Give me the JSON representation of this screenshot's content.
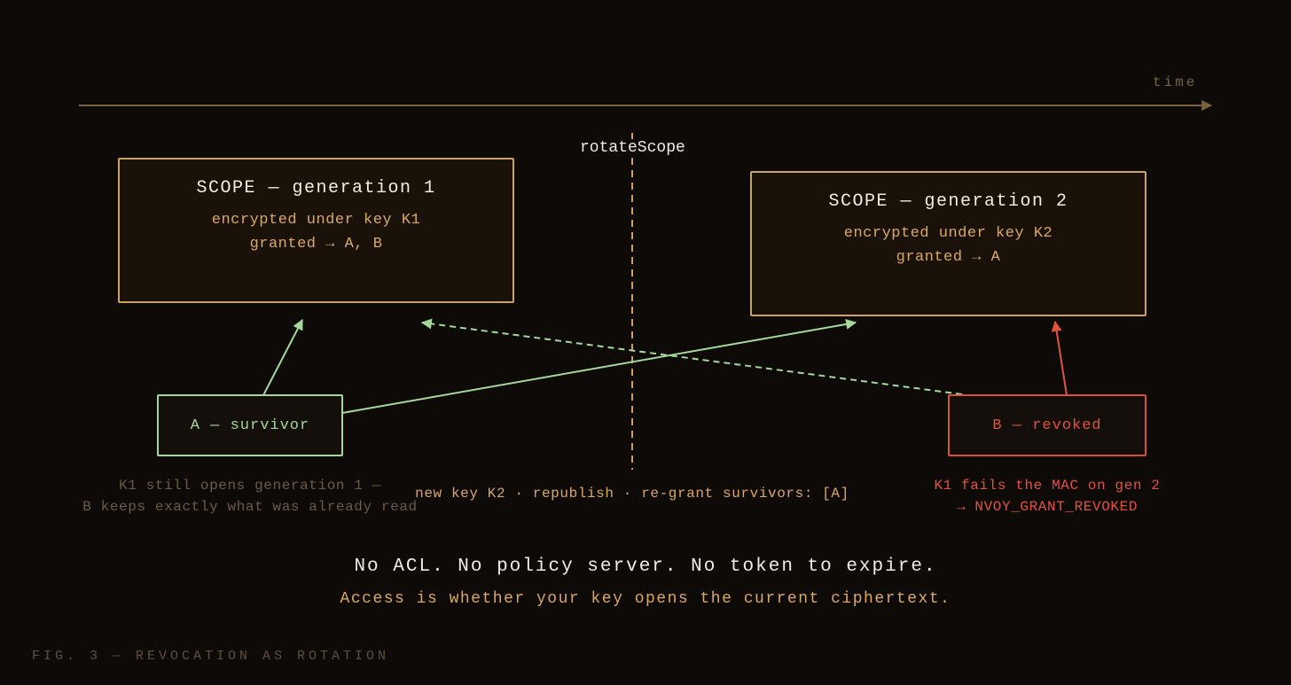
{
  "timeline": {
    "label": "time"
  },
  "rotation": {
    "label": "rotateScope",
    "caption": "new key K2 · republish · re-grant survivors: [A]"
  },
  "scopes": [
    {
      "title": "SCOPE — generation 1",
      "key_line": "encrypted under key K1",
      "grant_line": "granted → A, B"
    },
    {
      "title": "SCOPE — generation 2",
      "key_line": "encrypted under key K2",
      "grant_line": "granted → A"
    }
  ],
  "actors": {
    "a": {
      "label": "A — survivor",
      "note_lines": [
        "K1 still opens generation 1 —",
        "B keeps exactly what was already read"
      ]
    },
    "b": {
      "label": "B — revoked",
      "note_lines": [
        "K1 fails the MAC on gen 2",
        "→ NVOY_GRANT_REVOKED"
      ]
    }
  },
  "summary": {
    "headline": "No ACL. No policy server. No token to expire.",
    "subline": "Access is whether your key opens the current ciphertext."
  },
  "figure_caption": "FIG. 3 — REVOCATION AS ROTATION",
  "colors": {
    "background": "#0d0a08",
    "timeline": "#7a6240",
    "box_border": "#c9a26a",
    "box_fill": "#1a1208",
    "survivor": "#a6d89a",
    "revoked": "#e0543f",
    "amber": "#d9a868",
    "muted": "#6b5a45"
  }
}
